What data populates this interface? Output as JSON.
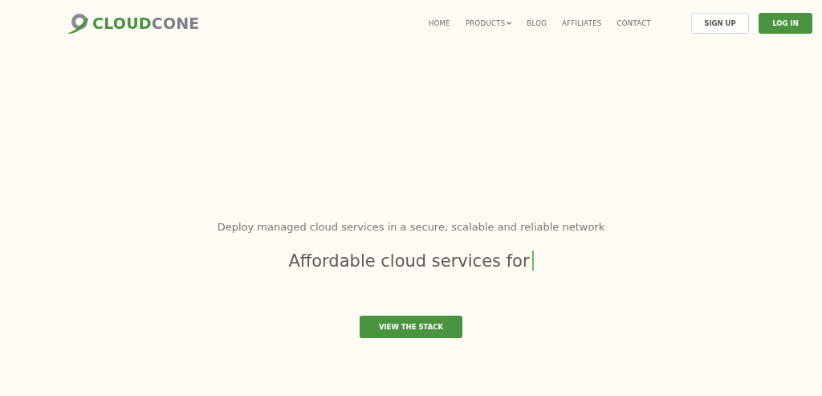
{
  "logo": {
    "first": "CLOUD",
    "second": "CONE"
  },
  "nav": [
    {
      "label": "HOME",
      "kind": "link"
    },
    {
      "label": "PRODUCTS",
      "kind": "dropdown"
    },
    {
      "label": "BLOG",
      "kind": "link"
    },
    {
      "label": "AFFILIATES",
      "kind": "link"
    },
    {
      "label": "CONTACT",
      "kind": "link"
    }
  ],
  "buttons": [
    {
      "label": "SIGN UP",
      "kind": "outline"
    },
    {
      "label": "LOG IN",
      "kind": "primary"
    }
  ],
  "hero": {
    "subtitle": "Deploy managed cloud services in a secure, scalable and reliable network",
    "headline": "Affordable cloud services for",
    "cta": "VIEW THE STACK"
  }
}
